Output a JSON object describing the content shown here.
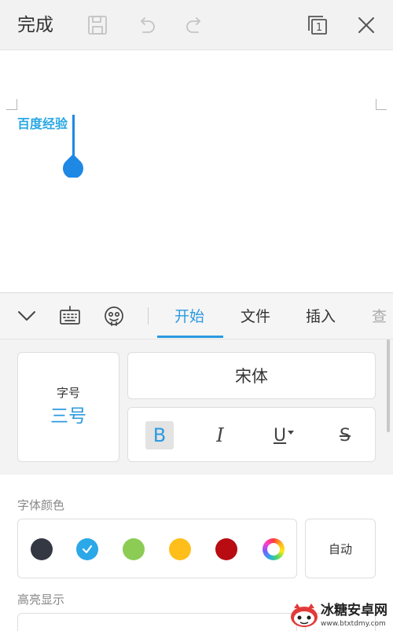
{
  "topbar": {
    "done_label": "完成",
    "icons": [
      "save-icon",
      "undo-icon",
      "redo-icon",
      "page-view-icon",
      "close-icon"
    ],
    "page_view_number": "1"
  },
  "document": {
    "text": "百度经验",
    "text_color": "#29a7e3",
    "cursor_color": "#1e88e5"
  },
  "toolbar": {
    "icons": [
      "collapse-chevron-icon",
      "keyboard-icon",
      "emoji-icon"
    ],
    "tabs": [
      {
        "label": "开始",
        "active": true
      },
      {
        "label": "文件",
        "active": false
      },
      {
        "label": "插入",
        "active": false
      },
      {
        "label": "查",
        "active": false
      }
    ],
    "accent_color": "#2b9ae0"
  },
  "format_panel": {
    "font_size_label": "字号",
    "font_size_value": "三号",
    "font_name": "宋体",
    "style_buttons": [
      {
        "name": "bold",
        "glyph": "B",
        "active": true
      },
      {
        "name": "italic",
        "glyph": "I",
        "active": false
      },
      {
        "name": "underline",
        "glyph": "U",
        "active": false
      },
      {
        "name": "strikethrough",
        "glyph": "S",
        "active": false
      }
    ]
  },
  "font_color": {
    "title": "字体颜色",
    "swatches": [
      "#333842",
      "#2aa8e8",
      "#8ccc55",
      "#ffbe1a",
      "#b80b12",
      "multicolor"
    ],
    "selected_index": 1,
    "auto_label": "自动"
  },
  "highlight": {
    "title": "高亮显示"
  },
  "watermark": {
    "title": "冰糖安卓网",
    "url": "www.btxtdmy.com"
  }
}
